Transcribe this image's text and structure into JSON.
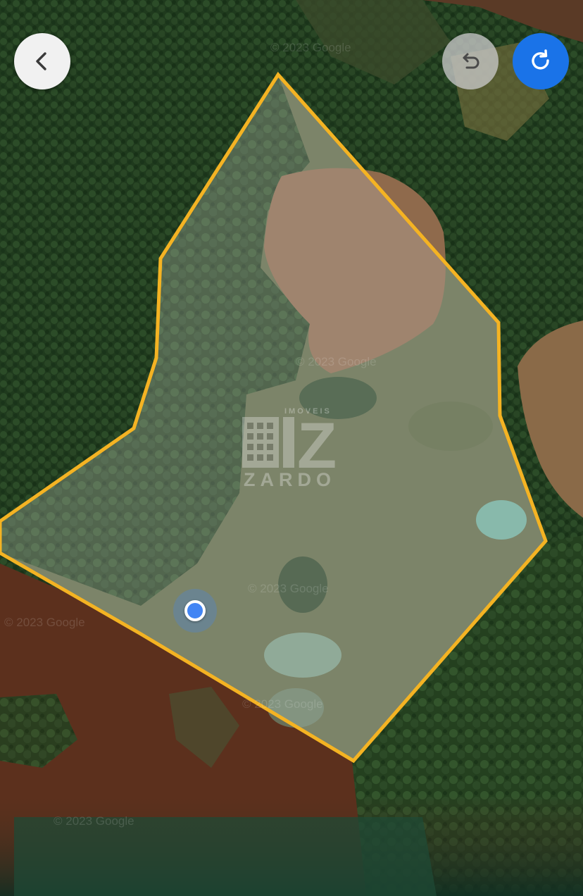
{
  "map": {
    "type": "satellite",
    "watermarks": [
      "2023 Google",
      "2023 Google",
      "2023 Google",
      "2023 Google",
      "2023 Google",
      "2023 Google"
    ],
    "boundary_color": "#f4b323",
    "boundary_fill": "rgba(200,200,200,0.28)"
  },
  "logo": {
    "top_text": "IMOVEIS",
    "bottom_text": "ZARDO",
    "mark_text": "Z"
  },
  "toolbar": {
    "back_icon": "chevron-left-icon",
    "undo_icon": "undo-icon",
    "redo_icon": "redo-icon",
    "redo_color": "#1a73e8"
  },
  "location_marker": {
    "icon": "current-location-dot",
    "color": "#4285f4"
  }
}
